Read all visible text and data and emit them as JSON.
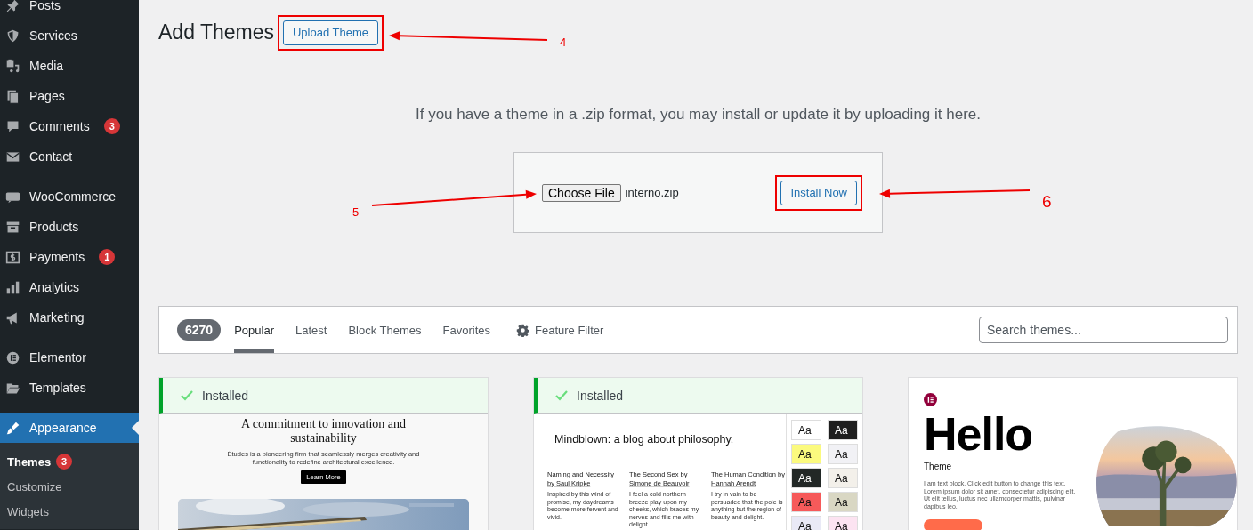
{
  "sidebar": {
    "groups": [
      {
        "items": [
          {
            "label": "Posts",
            "selected": false
          },
          {
            "label": "Services",
            "selected": false
          },
          {
            "label": "Media",
            "selected": false
          },
          {
            "label": "Pages",
            "selected": false
          },
          {
            "label": "Comments",
            "badge": "3",
            "selected": false
          },
          {
            "label": "Contact",
            "selected": false
          }
        ]
      },
      {
        "items": [
          {
            "label": "WooCommerce",
            "selected": false
          },
          {
            "label": "Products",
            "selected": false
          },
          {
            "label": "Payments",
            "badge": "1",
            "selected": false
          },
          {
            "label": "Analytics",
            "selected": false
          },
          {
            "label": "Marketing",
            "selected": false
          }
        ]
      },
      {
        "items": [
          {
            "label": "Elementor",
            "selected": false
          },
          {
            "label": "Templates",
            "selected": false
          }
        ]
      },
      {
        "items": [
          {
            "label": "Appearance",
            "selected": true,
            "children": [
              {
                "label": "Themes",
                "badge": "3",
                "selected": true
              },
              {
                "label": "Customize",
                "selected": false
              },
              {
                "label": "Widgets",
                "selected": false
              }
            ]
          }
        ]
      }
    ]
  },
  "header": {
    "title": "Add Themes",
    "upload_button": {
      "label": "Upload Theme",
      "highlighted": true
    }
  },
  "upload": {
    "description": "If you have a theme in a .zip format, you may install or update it by uploading it here.",
    "choose_button": "Choose File",
    "file_name": "interno.zip",
    "install_button": {
      "label": "Install Now",
      "highlighted": true
    }
  },
  "filter_bar": {
    "count": "6270",
    "tabs": [
      {
        "label": "Popular",
        "selected": true
      },
      {
        "label": "Latest",
        "selected": false
      },
      {
        "label": "Block Themes",
        "selected": false
      },
      {
        "label": "Favorites",
        "selected": false
      }
    ],
    "feature_filter": "Feature Filter",
    "search": {
      "placeholder": "Search themes..."
    }
  },
  "themes": [
    {
      "installed": true,
      "installed_label": "Installed",
      "preview": {
        "kind": "business",
        "heading": "A commitment to innovation and sustainability",
        "text": "Études is a pioneering firm that seamlessly merges creativity and functionality to redefine architectural excellence.",
        "button": "Learn More"
      }
    },
    {
      "installed": true,
      "installed_label": "Installed",
      "preview": {
        "kind": "blog",
        "heading": "Mindblown: a blog about philosophy.",
        "books": [
          {
            "title": "Naming and Necessity by Saul Kripke",
            "text": "Inspired by this wind of promise, my daydreams become more fervent and vivid."
          },
          {
            "title": "The Second Sex by Simone de Beauvoir",
            "text": "I feel a cold northern breeze play upon my cheeks, which braces my nerves and fills me with delight."
          },
          {
            "title": "The Human Condition by Hannah Arendt",
            "text": "I try in vain to be persuaded that the pole is anything but the region of beauty and delight."
          }
        ],
        "swatches": [
          {
            "label": "Aa",
            "color": "#ffffff"
          },
          {
            "label": "Aa",
            "color": "#1e1e1e"
          },
          {
            "label": "Aa",
            "color": "#fbfa7e"
          },
          {
            "label": "Aa",
            "color": "#f1f1f5"
          },
          {
            "label": "Aa",
            "color": "#222826"
          },
          {
            "label": "Aa",
            "color": "#f3f0ea"
          },
          {
            "label": "Aa",
            "color": "#f65a5a"
          },
          {
            "label": "Aa",
            "color": "#d9d7c3"
          },
          {
            "label": "Aa",
            "color": "#e9e9f6"
          },
          {
            "label": "Aa",
            "color": "#fce3f1"
          }
        ]
      }
    },
    {
      "installed": false,
      "preview": {
        "kind": "hello",
        "title": "Hello",
        "subtitle": "Theme",
        "text": "I am text block. Click edit button to change this text. Lorem ipsum dolor sit amet, consectetur adipiscing elit. Ut elit tellus, luctus nec ullamcorper mattis, pulvinar dapibus leo."
      }
    }
  ],
  "annotations": [
    {
      "number": "4"
    },
    {
      "number": "5"
    },
    {
      "number": "6"
    }
  ]
}
